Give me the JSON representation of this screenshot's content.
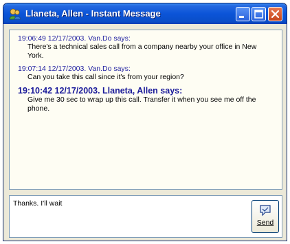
{
  "window": {
    "title": "Llaneta, Allen - Instant Message"
  },
  "history": {
    "messages": [
      {
        "header": "19:06:49 12/17/2003. Van.Do says:",
        "body": "There's a technical sales call from a company nearby your office in New York."
      },
      {
        "header": "19:07:14 12/17/2003. Van.Do says:",
        "body": "Can you take this call since it's from your region?"
      },
      {
        "header": "19:10:42 12/17/2003. Llaneta, Allen says:",
        "body": "Give me 30 sec to wrap up this call. Transfer it when you see me off the phone."
      }
    ]
  },
  "compose": {
    "value": "Thanks. I'll wait"
  },
  "send_button": {
    "label": "Send"
  }
}
